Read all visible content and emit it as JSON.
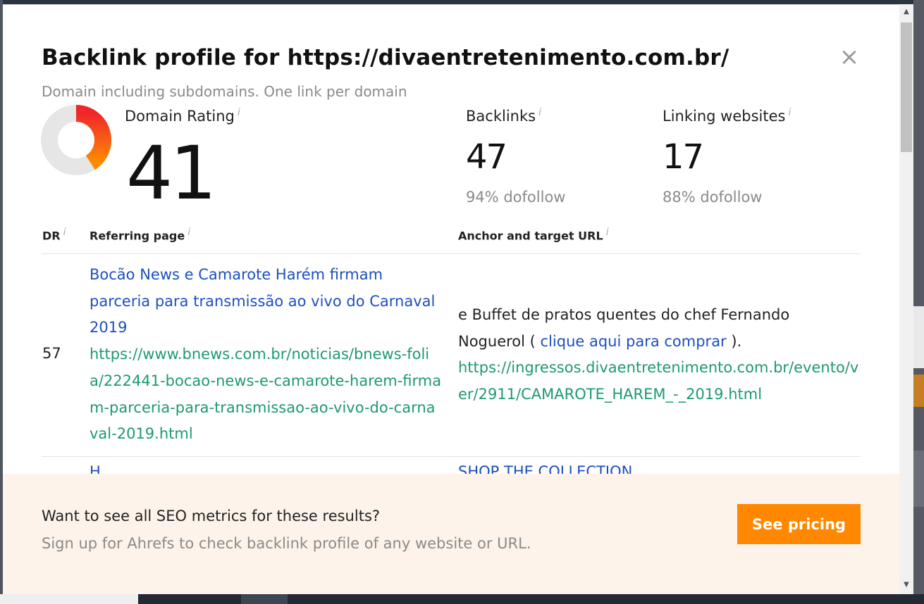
{
  "modal": {
    "title": "Backlink profile for https://divaentretenimento.com.br/",
    "close_symbol": "×",
    "subtitle": "Domain including subdomains. One link per domain"
  },
  "metrics": {
    "info_symbol": "i",
    "domain_rating": {
      "label": "Domain Rating",
      "value": "41",
      "fraction": 0.41
    },
    "backlinks": {
      "label": "Backlinks",
      "value": "47",
      "sub": "94% dofollow"
    },
    "linking_websites": {
      "label": "Linking websites",
      "value": "17",
      "sub": "88% dofollow"
    }
  },
  "table": {
    "headers": {
      "dr": "DR",
      "referring_page": "Referring page",
      "anchor": "Anchor and target URL"
    },
    "rows": [
      {
        "dr": "57",
        "ref_title": "Bocão News e Camarote Harém firmam parceria para transmissão ao vivo do Carnaval 2019",
        "ref_url": "https://www.bnews.com.br/noticias/bnews-folia/222441-bocao-news-e-camarote-harem-firmam-parceria-para-transmissao-ao-vivo-do-carnaval-2019.html",
        "anchor_before": "e Buffet de pratos quentes do chef Fernando Noguerol (",
        "anchor_link": "clique aqui para comprar",
        "anchor_after": ").",
        "target_url": "https://ingressos.divaentretenimento.com.br/evento/ver/2911/CAMAROTE_HAREM_-_2019.html"
      }
    ],
    "clipped_row": {
      "ref_fragment": "H",
      "anchor_fragment": "SHOP THE COLLECTION"
    }
  },
  "cta": {
    "title": "Want to see all SEO metrics for these results?",
    "subtitle": "Sign up for Ahrefs to check backlink profile of any website or URL.",
    "button": "See pricing"
  },
  "colors": {
    "accent_orange": "#ff8800",
    "link_blue": "#1d4fbf",
    "link_green": "#1d9a6c",
    "donut_track": "#e6e6e6",
    "donut_start": "#f0262b",
    "donut_end": "#ff8c00"
  }
}
